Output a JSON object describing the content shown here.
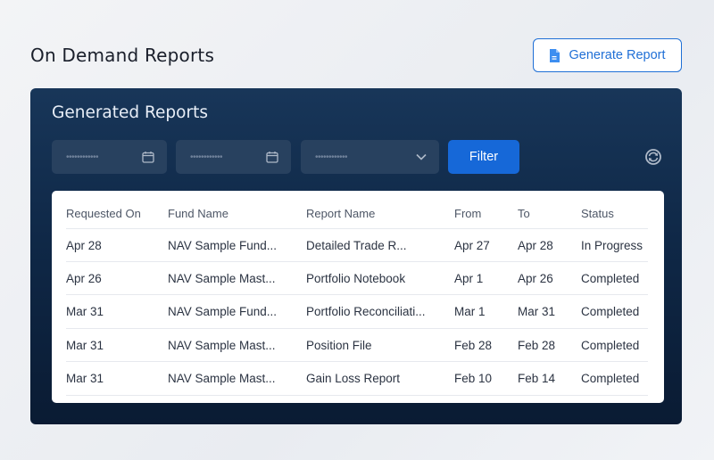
{
  "header": {
    "title": "On Demand Reports",
    "generate_label": "Generate Report"
  },
  "panel": {
    "title": "Generated Reports",
    "date_from_placeholder": "••••••••••••",
    "date_to_placeholder": "••••••••••••",
    "select_placeholder": "••••••••••••",
    "filter_label": "Filter"
  },
  "table": {
    "columns": [
      "Requested On",
      "Fund Name",
      "Report Name",
      "From",
      "To",
      "Status"
    ],
    "rows": [
      [
        "Apr 28",
        "NAV Sample Fund...",
        "Detailed Trade R...",
        "Apr 27",
        "Apr 28",
        "In Progress"
      ],
      [
        "Apr 26",
        "NAV Sample Mast...",
        "Portfolio Notebook",
        "Apr 1",
        "Apr 26",
        "Completed"
      ],
      [
        "Mar 31",
        "NAV Sample Fund...",
        "Portfolio Reconciliati...",
        "Mar 1",
        "Mar 31",
        "Completed"
      ],
      [
        "Mar 31",
        "NAV Sample Mast...",
        "Position File",
        "Feb 28",
        "Feb 28",
        "Completed"
      ],
      [
        "Mar 31",
        "NAV Sample Mast...",
        "Gain Loss Report",
        "Feb 10",
        "Feb 14",
        "Completed"
      ]
    ]
  },
  "icons": {
    "generate": "document-icon",
    "date": "calendar-icon",
    "select": "chevron-down-icon",
    "refresh": "refresh-icon"
  },
  "colors": {
    "accent": "#1f6fd6",
    "filter_button": "#1668d8",
    "panel_bg": "#0f2847"
  }
}
